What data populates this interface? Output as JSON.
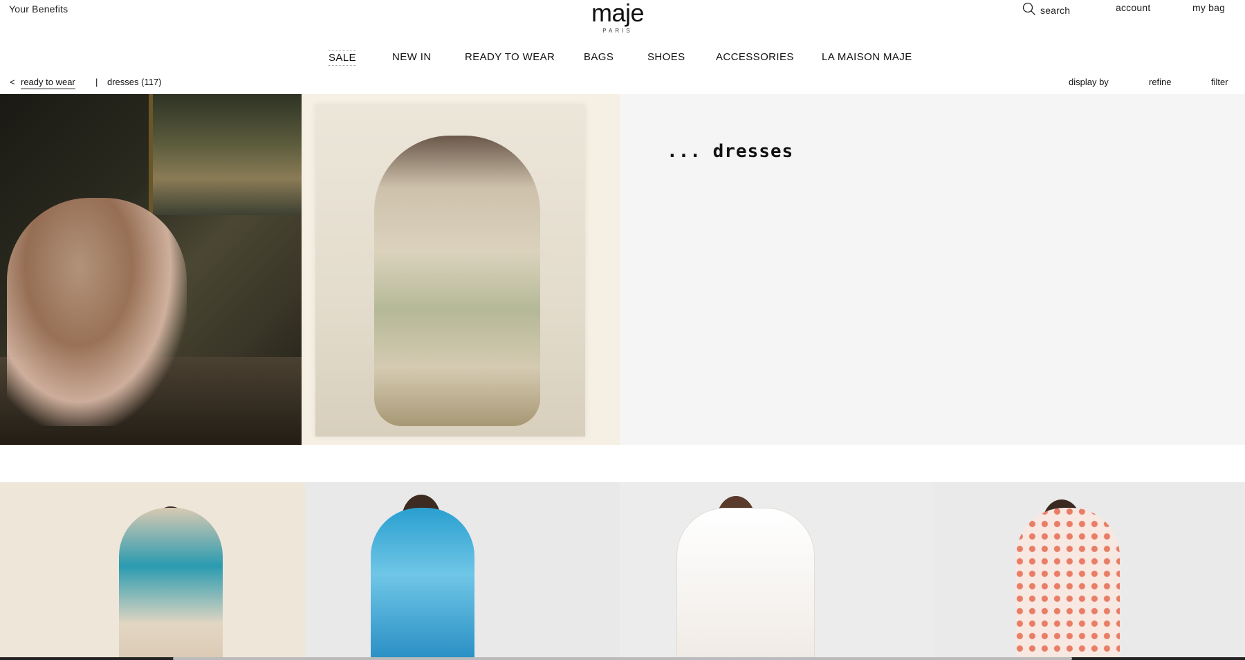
{
  "header": {
    "benefits": "Your Benefits",
    "logo_word": "maje",
    "logo_sub": "PARIS",
    "search_label": "search",
    "search_icon": "search-icon",
    "account_label": "account",
    "bag_label": "my bag"
  },
  "nav": {
    "items": [
      "SALE",
      "NEW IN",
      "READY TO WEAR",
      "BAGS",
      "SHOES",
      "ACCESSORIES",
      "LA MAISON MAJE"
    ]
  },
  "breadcrumb": {
    "back_glyph": "<",
    "parent": "ready to wear",
    "separator": "|",
    "current": "dresses (117)"
  },
  "toolbar": {
    "display_by": "display by",
    "refine": "refine",
    "filter": "filter"
  },
  "hero": {
    "title": "... dresses"
  },
  "colors": {
    "text": "#111111",
    "panel_bg": "#f5f5f5"
  }
}
